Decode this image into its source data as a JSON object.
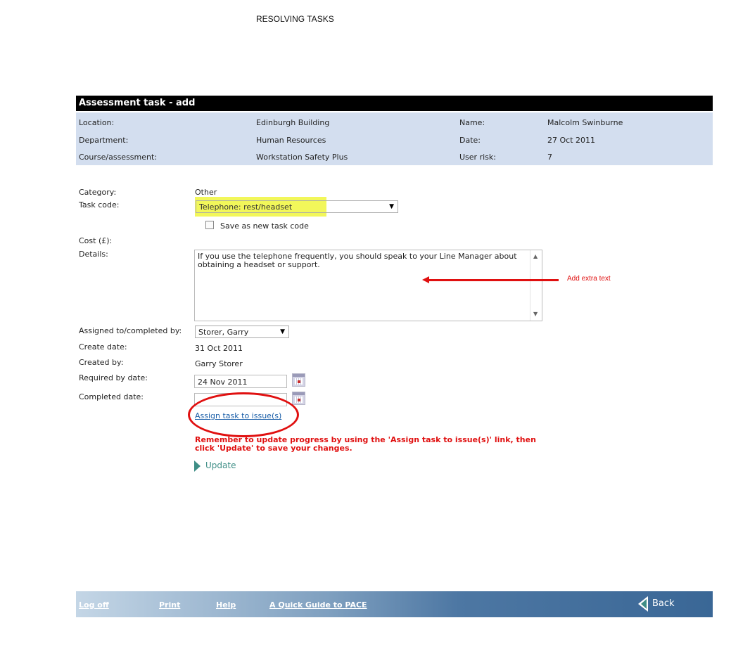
{
  "document_title": "RESOLVING TASKS",
  "form": {
    "title": "Assessment task - add",
    "info": {
      "location_label": "Location:",
      "location_value": "Edinburgh Building",
      "name_label": "Name:",
      "name_value": "Malcolm Swinburne",
      "department_label": "Department:",
      "department_value": "Human Resources",
      "date_label": "Date:",
      "date_value": "27 Oct 2011",
      "course_label": "Course/assessment:",
      "course_value": "Workstation Safety Plus",
      "user_risk_label": "User risk:",
      "user_risk_value": "7"
    },
    "category_label": "Category:",
    "category_value": "Other",
    "task_code_label": "Task code:",
    "task_code_value": "Telephone: rest/headset",
    "save_new_code_label": "Save as new task code",
    "save_new_code_checked": false,
    "cost_label": "Cost (£):",
    "details_label": "Details:",
    "details_value": "If you use the telephone frequently, you should speak to your Line Manager about obtaining a headset or support.",
    "assigned_label": "Assigned to/completed by:",
    "assigned_value": "Storer, Garry",
    "create_date_label": "Create date:",
    "create_date_value": "31 Oct 2011",
    "created_by_label": "Created by:",
    "created_by_value": "Garry Storer",
    "required_by_label": "Required by date:",
    "required_by_value": "24 Nov 2011",
    "completed_date_label": "Completed date:",
    "completed_date_value": "",
    "assign_link": "Assign task to issue(s)",
    "warning": "Remember to update progress by using the 'Assign task to issue(s)' link, then click 'Update' to save your changes.",
    "update_label": "Update"
  },
  "annotation": {
    "text": "Add extra text",
    "color": "#e01010"
  },
  "footer": {
    "log_off": "Log off",
    "print": "Print",
    "help": "Help",
    "quick_guide": "A Quick Guide to PACE",
    "back": "Back"
  },
  "colors": {
    "header_bg": "#000000",
    "info_panel_bg": "#d3deef",
    "highlight": "#f2f75a",
    "link": "#1a5ea8",
    "accent_teal": "#3e8e86",
    "footer_dark": "#3a6796"
  }
}
